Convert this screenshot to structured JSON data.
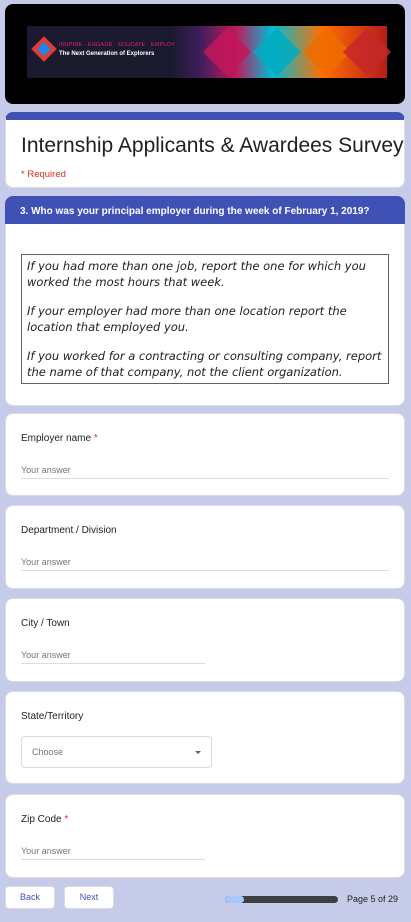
{
  "banner": {
    "tagline": "INSPIRE · ENGAGE · EDUCATE · EMPLOY",
    "subtitle": "The Next Generation of Explorers"
  },
  "form": {
    "title": "Internship Applicants & Awardees Survey",
    "required_note": "* Required"
  },
  "section": {
    "header": "3. Who was your principal employer during the week of February 1, 2019?",
    "description": [
      "If you had more than one job, report the one for which you worked the most hours that week.",
      "If your employer had more than one location report the location that employed you.",
      "If you worked for a contracting or consulting company, report the name of that company, not the client organization."
    ]
  },
  "questions": {
    "employer": {
      "label": "Employer name",
      "required_mark": "*",
      "placeholder": "Your answer"
    },
    "department": {
      "label": "Department / Division",
      "placeholder": "Your answer"
    },
    "city": {
      "label": "City / Town",
      "placeholder": "Your answer"
    },
    "state": {
      "label": "State/Territory",
      "selected": "Choose"
    },
    "zip": {
      "label": "Zip Code",
      "required_mark": "*",
      "placeholder": "Your answer"
    }
  },
  "nav": {
    "back_label": "Back",
    "next_label": "Next",
    "page_label": "Page 5 of 29",
    "progress_fraction": 0.1724
  },
  "colors": {
    "accent": "#3f51b5",
    "background": "#c5cbe9",
    "required": "#d93025"
  }
}
